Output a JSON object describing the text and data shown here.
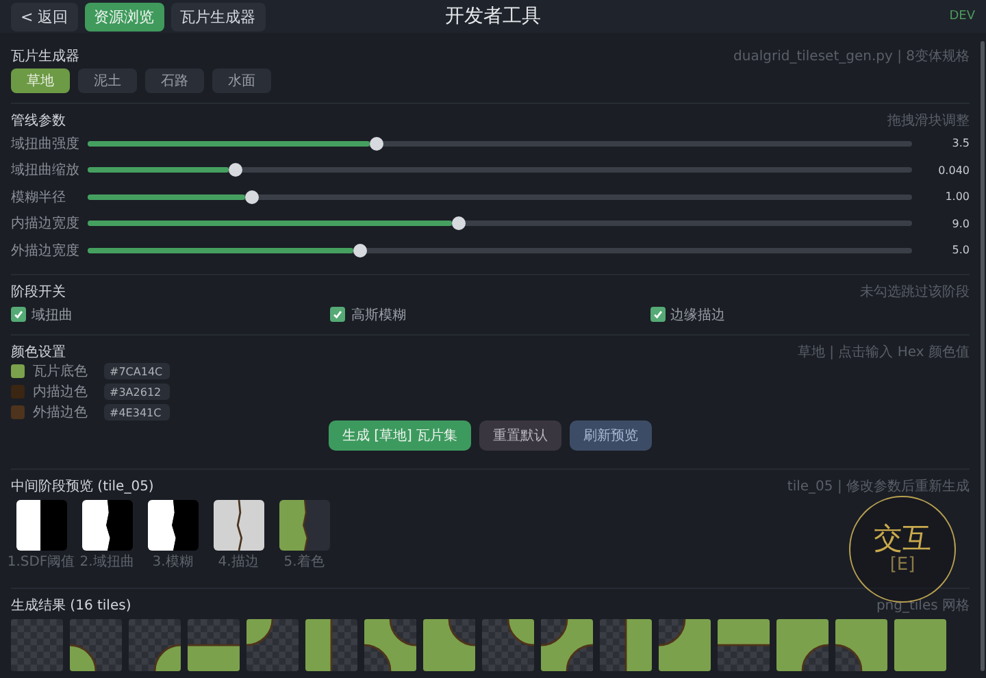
{
  "header": {
    "back_button": "< 返回",
    "tabs": [
      {
        "label": "资源浏览",
        "selected": true
      },
      {
        "label": "瓦片生成器",
        "selected": false
      }
    ],
    "title": "开发者工具",
    "badge": "DEV"
  },
  "generator": {
    "title": "瓦片生成器",
    "hint": "dualgrid_tileset_gen.py | 8变体规格",
    "presets": [
      {
        "label": "草地",
        "selected": true
      },
      {
        "label": "泥土",
        "selected": false
      },
      {
        "label": "石路",
        "selected": false
      },
      {
        "label": "水面",
        "selected": false
      }
    ]
  },
  "pipeline": {
    "title": "管线参数",
    "hint": "拖拽滑块调整",
    "sliders": [
      {
        "label": "域扭曲强度",
        "level": 0.35,
        "reading": "3.5"
      },
      {
        "label": "域扭曲缩放",
        "level": 0.18,
        "reading": "0.040"
      },
      {
        "label": "模糊半径",
        "level": 0.2,
        "reading": "1.00"
      },
      {
        "label": "内描边宽度",
        "level": 0.45,
        "reading": "9.0"
      },
      {
        "label": "外描边宽度",
        "level": 0.33,
        "reading": "5.0"
      }
    ]
  },
  "stages": {
    "title": "阶段开关",
    "hint": "未勾选跳过该阶段",
    "toggles": [
      {
        "label": "域扭曲",
        "checked": true
      },
      {
        "label": "高斯模糊",
        "checked": true
      },
      {
        "label": "边缘描边",
        "checked": true
      }
    ]
  },
  "colors": {
    "title": "颜色设置",
    "hint": "草地 | 点击输入 Hex 颜色值",
    "items": [
      {
        "label": "瓦片底色",
        "value": "#7CA14C",
        "color": "#7ca14c"
      },
      {
        "label": "内描边色",
        "value": "#3A2612",
        "color": "#3a2612"
      },
      {
        "label": "外描边色",
        "value": "#4E341C",
        "color": "#4e341c"
      }
    ]
  },
  "actions": [
    {
      "label": "生成 [草地] 瓦片集",
      "kind": "primary"
    },
    {
      "label": "重置默认",
      "kind": "secondary"
    },
    {
      "label": "刷新预览",
      "kind": "info"
    }
  ],
  "preview": {
    "title": "中间阶段预览 (tile_05)",
    "hint": "tile_05 | 修改参数后重新生成",
    "stages": [
      {
        "label": "1.SDF阈值",
        "kind": "mask"
      },
      {
        "label": "2.域扭曲",
        "kind": "warp"
      },
      {
        "label": "3.模糊",
        "kind": "warp"
      },
      {
        "label": "4.描边",
        "kind": "outline"
      },
      {
        "label": "5.着色",
        "kind": "color"
      }
    ]
  },
  "results": {
    "title": "生成结果 (16 tiles)",
    "hint": "png_tiles 网格"
  },
  "interact": {
    "label": "交互",
    "key": "[E]"
  }
}
